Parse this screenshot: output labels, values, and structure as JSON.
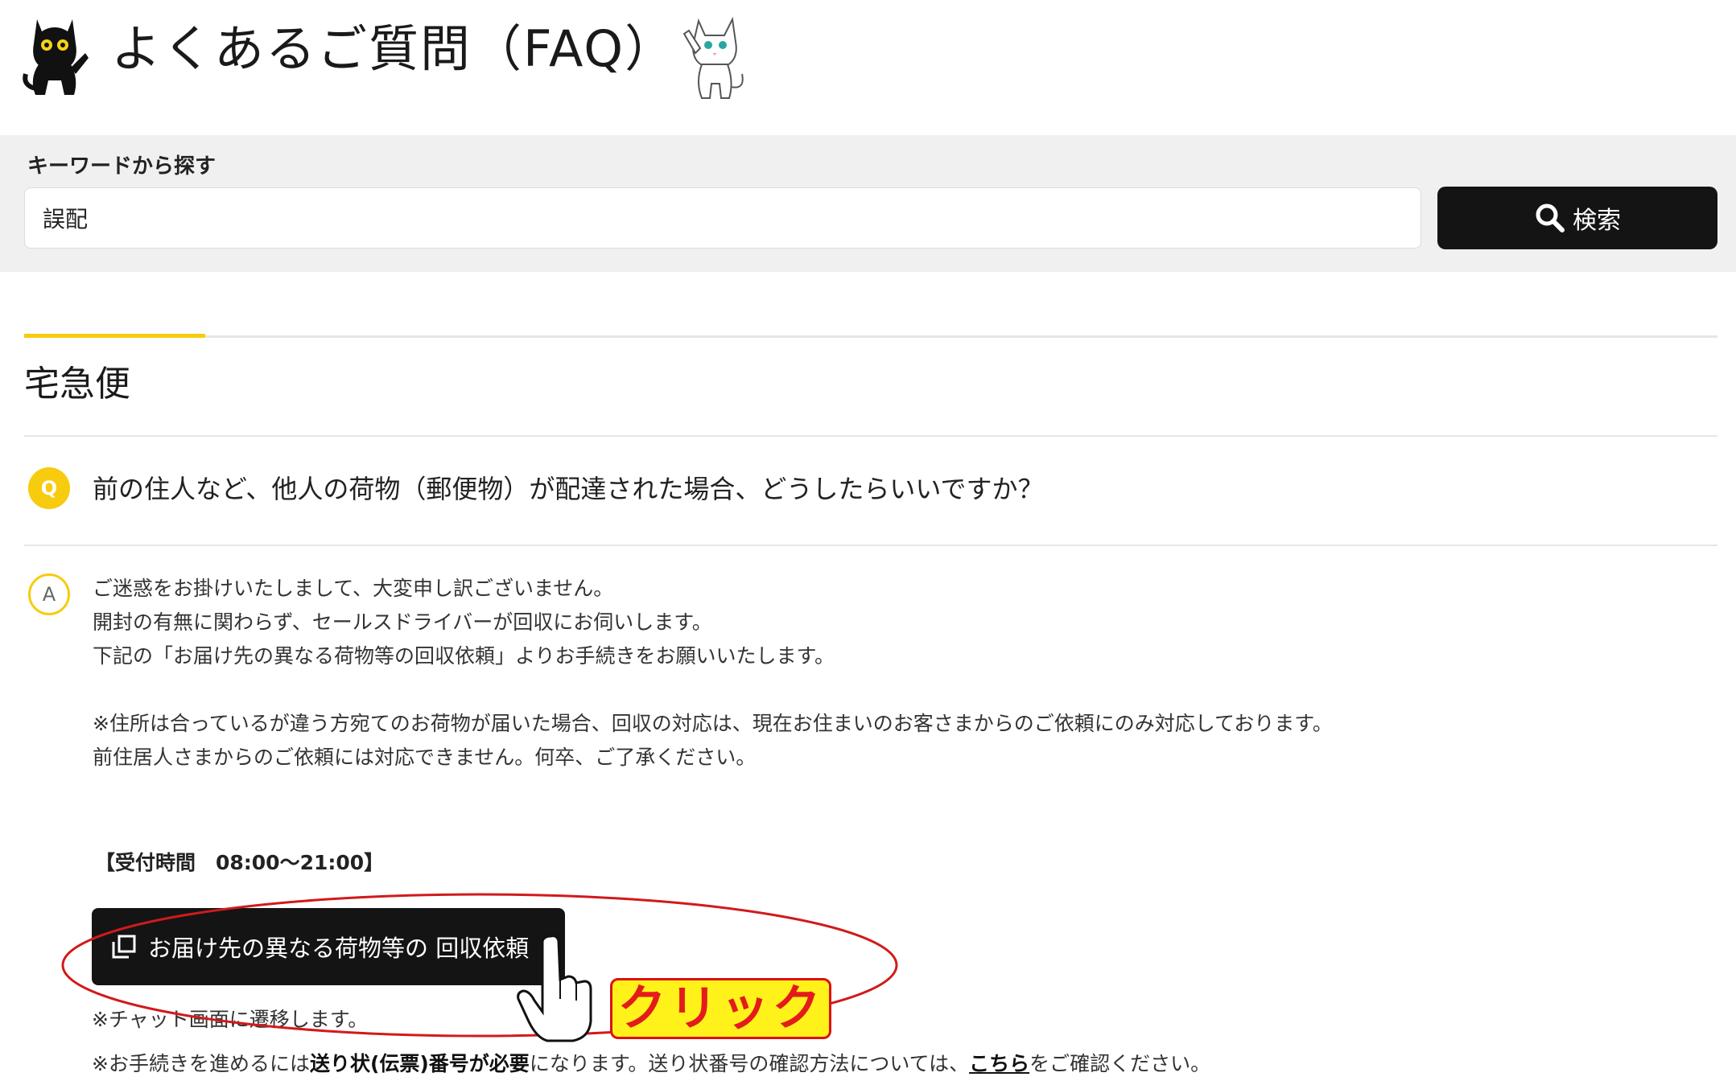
{
  "header": {
    "title": "よくあるご質問（FAQ）",
    "left_icon": "black-cat-mascot-icon",
    "right_icon": "white-cat-mascot-icon"
  },
  "search": {
    "label": "キーワードから探す",
    "value": "誤配",
    "button_label": "検索",
    "button_icon": "search-icon"
  },
  "category": {
    "title": "宅急便"
  },
  "question": {
    "badge": "Q",
    "text": "前の住人など、他人の荷物（郵便物）が配達された場合、どうしたらいいですか？"
  },
  "answer": {
    "badge": "A",
    "lines": [
      "ご迷惑をお掛けいたしまして、大変申し訳ございません。",
      "開封の有無に関わらず、セールスドライバーが回収にお伺いします。",
      "下記の「お届け先の異なる荷物等の回収依頼」よりお手続きをお願いいたします。",
      "※住所は合っているが違う方宛てのお荷物が届いた場合、回収の対応は、現在お住まいのお客さまからのご依頼にのみ対応しております。",
      "前住居人さまからのご依頼には対応できません。何卒、ご了承ください。"
    ],
    "hours": "【受付時間　08:00～21:00】",
    "cta_label": "お届け先の異なる荷物等の 回収依頼",
    "cta_icon": "external-window-icon",
    "chat_note": "※チャット画面に遷移します。",
    "procedure": {
      "prefix": "※お手続きを進めるには",
      "bold": "送り状(伝票)番号が必要",
      "middle": "になります。送り状番号の確認方法については、",
      "link": "こちら",
      "suffix": "をご確認ください。"
    }
  },
  "annotation": {
    "click_label": "クリック",
    "hand_icon": "pointing-hand-icon",
    "highlight_color": "#d11a1a",
    "badge_color": "#fff21a"
  },
  "colors": {
    "accent": "#f7cb0e",
    "button_bg": "#141414",
    "band_bg": "#f0f0f0"
  }
}
